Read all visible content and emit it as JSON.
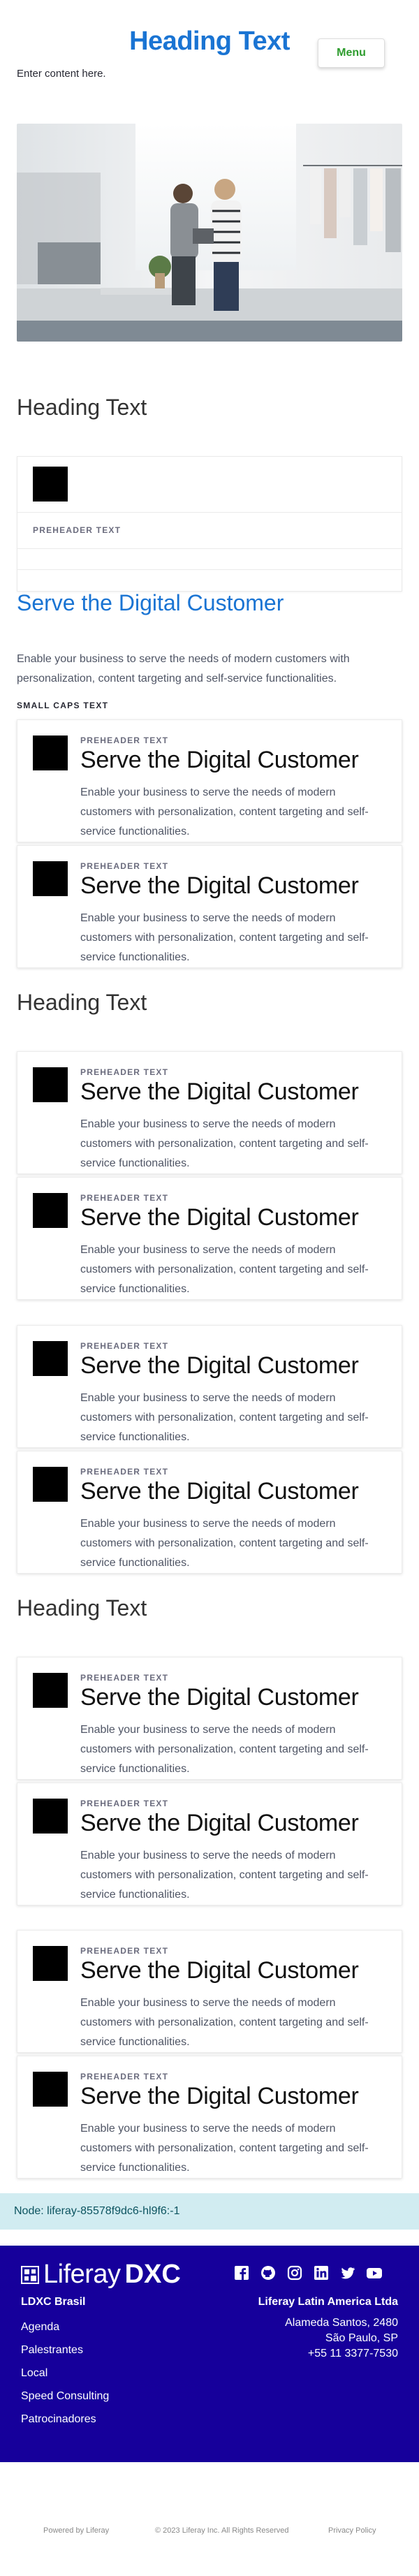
{
  "header": {
    "title": "Heading Text",
    "menu_label": "Menu",
    "intro": "Enter content here."
  },
  "hero": {
    "alt": "Two people looking at a tablet in a clothing studio"
  },
  "section1": {
    "heading": "Heading Text"
  },
  "list": {
    "preheader": "PREHEADER TEXT"
  },
  "feature": {
    "title": "Serve the Digital Customer",
    "description": "Enable your business to serve the needs of modern customers with personalization, content targeting and self-service functionalities.",
    "small_caps": "SMALL CAPS TEXT"
  },
  "card": {
    "preheader": "PREHEADER TEXT",
    "title": "Serve the Digital Customer",
    "description": "Enable your business to serve the needs of modern customers with personalization, content targeting and self-service functionalities."
  },
  "section2": {
    "heading": "Heading Text"
  },
  "section3": {
    "heading": "Heading Text"
  },
  "node": {
    "text": "Node: liferay-85578f9dc6-hl9f6:-1"
  },
  "footer": {
    "logo_text": "Liferay",
    "logo_suffix": "DXC",
    "brand_sub": "LDXC Brasil",
    "links": [
      "Agenda",
      "Palestrantes",
      "Local",
      "Speed Consulting",
      "Patrocinadores"
    ],
    "company": "Liferay Latin America Ltda",
    "address": [
      "Alameda Santos, 2480",
      "São Paulo, SP",
      "+55 11 3377-7530"
    ],
    "socials": [
      "facebook-icon",
      "github-icon",
      "instagram-icon",
      "linkedin-icon",
      "twitter-icon",
      "youtube-icon"
    ],
    "colors": {
      "background": "#16009b",
      "accent": "#1a74d3"
    }
  },
  "bottom": {
    "powered": "Powered by Liferay",
    "copyright": "© 2023 Liferay Inc. All Rights Reserved",
    "privacy": "Privacy Policy"
  }
}
